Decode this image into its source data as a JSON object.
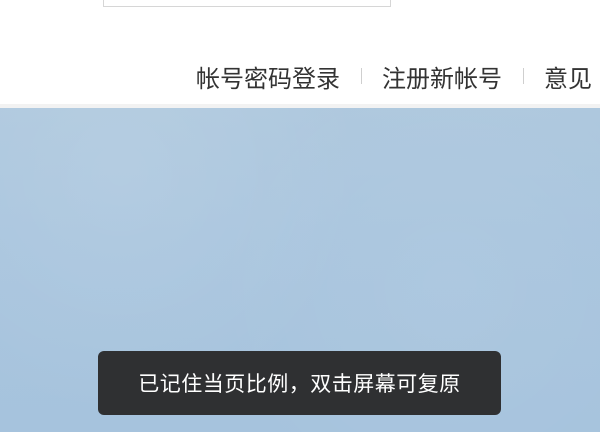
{
  "login_links": {
    "account_password_login": "帐号密码登录",
    "register_new_account": "注册新帐号",
    "feedback_partial": "意见"
  },
  "toast": {
    "message": "已记住当页比例，双击屏幕可复原"
  },
  "colors": {
    "background_panel": "#a9c5de",
    "toast_background": "#282828",
    "link_text": "#333333"
  }
}
